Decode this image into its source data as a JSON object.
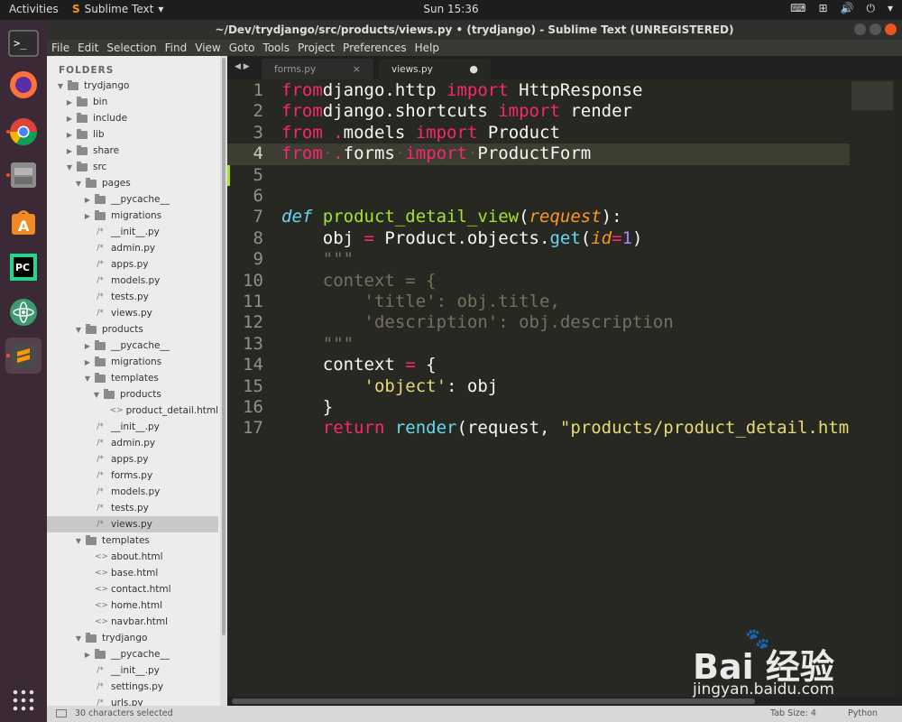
{
  "topbar": {
    "activities": "Activities",
    "app_name": "Sublime Text",
    "app_menu_arrow": "▾",
    "clock": "Sun 15:36",
    "tray": [
      "⌨",
      "⊞",
      "🔊",
      "⏻",
      "▾"
    ]
  },
  "window": {
    "title": "~/Dev/trydjango/src/products/views.py • (trydjango) - Sublime Text (UNREGISTERED)"
  },
  "menu": [
    "File",
    "Edit",
    "Selection",
    "Find",
    "View",
    "Goto",
    "Tools",
    "Project",
    "Preferences",
    "Help"
  ],
  "sidebar": {
    "header": "FOLDERS",
    "rows": [
      {
        "label": "trydjango",
        "depth": 0,
        "kind": "folder",
        "open": true
      },
      {
        "label": "bin",
        "depth": 1,
        "kind": "folder",
        "open": false
      },
      {
        "label": "include",
        "depth": 1,
        "kind": "folder",
        "open": false
      },
      {
        "label": "lib",
        "depth": 1,
        "kind": "folder",
        "open": false
      },
      {
        "label": "share",
        "depth": 1,
        "kind": "folder",
        "open": false
      },
      {
        "label": "src",
        "depth": 1,
        "kind": "folder",
        "open": true
      },
      {
        "label": "pages",
        "depth": 2,
        "kind": "folder",
        "open": true
      },
      {
        "label": "__pycache__",
        "depth": 3,
        "kind": "folder",
        "open": false
      },
      {
        "label": "migrations",
        "depth": 3,
        "kind": "folder",
        "open": false
      },
      {
        "label": "__init__.py",
        "depth": 3,
        "kind": "file"
      },
      {
        "label": "admin.py",
        "depth": 3,
        "kind": "file"
      },
      {
        "label": "apps.py",
        "depth": 3,
        "kind": "file"
      },
      {
        "label": "models.py",
        "depth": 3,
        "kind": "file"
      },
      {
        "label": "tests.py",
        "depth": 3,
        "kind": "file"
      },
      {
        "label": "views.py",
        "depth": 3,
        "kind": "file"
      },
      {
        "label": "products",
        "depth": 2,
        "kind": "folder",
        "open": true
      },
      {
        "label": "__pycache__",
        "depth": 3,
        "kind": "folder",
        "open": false
      },
      {
        "label": "migrations",
        "depth": 3,
        "kind": "folder",
        "open": false
      },
      {
        "label": "templates",
        "depth": 3,
        "kind": "folder",
        "open": true
      },
      {
        "label": "products",
        "depth": 4,
        "kind": "folder",
        "open": true
      },
      {
        "label": "product_detail.html",
        "depth": 5,
        "kind": "html"
      },
      {
        "label": "__init__.py",
        "depth": 3,
        "kind": "file"
      },
      {
        "label": "admin.py",
        "depth": 3,
        "kind": "file"
      },
      {
        "label": "apps.py",
        "depth": 3,
        "kind": "file"
      },
      {
        "label": "forms.py",
        "depth": 3,
        "kind": "file"
      },
      {
        "label": "models.py",
        "depth": 3,
        "kind": "file"
      },
      {
        "label": "tests.py",
        "depth": 3,
        "kind": "file"
      },
      {
        "label": "views.py",
        "depth": 3,
        "kind": "file",
        "selected": true
      },
      {
        "label": "templates",
        "depth": 2,
        "kind": "folder",
        "open": true
      },
      {
        "label": "about.html",
        "depth": 3,
        "kind": "html"
      },
      {
        "label": "base.html",
        "depth": 3,
        "kind": "html"
      },
      {
        "label": "contact.html",
        "depth": 3,
        "kind": "html"
      },
      {
        "label": "home.html",
        "depth": 3,
        "kind": "html"
      },
      {
        "label": "navbar.html",
        "depth": 3,
        "kind": "html"
      },
      {
        "label": "trydjango",
        "depth": 2,
        "kind": "folder",
        "open": true
      },
      {
        "label": "__pycache__",
        "depth": 3,
        "kind": "folder",
        "open": false
      },
      {
        "label": "__init__.py",
        "depth": 3,
        "kind": "file"
      },
      {
        "label": "settings.py",
        "depth": 3,
        "kind": "file"
      },
      {
        "label": "urls.py",
        "depth": 3,
        "kind": "file"
      }
    ]
  },
  "tabs": [
    {
      "label": "forms.py",
      "mark": "×",
      "active": false
    },
    {
      "label": "views.py",
      "mark": "●",
      "active": true
    }
  ],
  "tabnav": "◀ ▶",
  "editor": {
    "current_line": 4,
    "lines": [
      {
        "n": "1",
        "tokens": [
          [
            "kw",
            "from"
          ],
          [
            "",
            "django.http "
          ],
          [
            "kw",
            "import"
          ],
          [
            "",
            " HttpResponse"
          ]
        ]
      },
      {
        "n": "2",
        "tokens": [
          [
            "kw",
            "from"
          ],
          [
            "",
            "django.shortcuts "
          ],
          [
            "kw",
            "import"
          ],
          [
            "",
            " render"
          ]
        ]
      },
      {
        "n": "3",
        "tokens": [
          [
            "kw",
            "from"
          ],
          [
            "kw",
            " ."
          ],
          [
            "",
            "models "
          ],
          [
            "kw",
            "import"
          ],
          [
            "",
            " Product"
          ]
        ]
      },
      {
        "n": "4",
        "tokens": [
          [
            "kw",
            "from"
          ],
          [
            "ws",
            "·"
          ],
          [
            "kw",
            "."
          ],
          [
            "",
            "forms"
          ],
          [
            "ws",
            "·"
          ],
          [
            "kw",
            "import"
          ],
          [
            "ws",
            "·"
          ],
          [
            "",
            "ProductForm"
          ]
        ]
      },
      {
        "n": "5",
        "tokens": []
      },
      {
        "n": "6",
        "tokens": []
      },
      {
        "n": "7",
        "tokens": [
          [
            "def",
            "def"
          ],
          [
            "",
            " "
          ],
          [
            "fn",
            "product_detail_view"
          ],
          [
            "",
            "("
          ],
          [
            "param",
            "request"
          ],
          [
            "",
            "):"
          ]
        ]
      },
      {
        "n": "8",
        "tokens": [
          [
            "",
            "    obj "
          ],
          [
            "kw",
            "="
          ],
          [
            "",
            " Product.objects."
          ],
          [
            "bi",
            "get"
          ],
          [
            "",
            "("
          ],
          [
            "param",
            "id"
          ],
          [
            "kw",
            "="
          ],
          [
            "num",
            "1"
          ],
          [
            "",
            ")"
          ]
        ]
      },
      {
        "n": "9",
        "tokens": [
          [
            "cm",
            "    \"\"\""
          ]
        ]
      },
      {
        "n": "10",
        "tokens": [
          [
            "cm",
            "    context = {"
          ]
        ]
      },
      {
        "n": "11",
        "tokens": [
          [
            "cm",
            "        'title': obj.title,"
          ]
        ]
      },
      {
        "n": "12",
        "tokens": [
          [
            "cm",
            "        'description': obj.description"
          ]
        ]
      },
      {
        "n": "13",
        "tokens": [
          [
            "cm",
            "    \"\"\""
          ]
        ]
      },
      {
        "n": "14",
        "tokens": [
          [
            "",
            "    context "
          ],
          [
            "kw",
            "="
          ],
          [
            "",
            " {"
          ]
        ]
      },
      {
        "n": "15",
        "tokens": [
          [
            "",
            "        "
          ],
          [
            "str",
            "'object'"
          ],
          [
            "",
            ": obj"
          ]
        ]
      },
      {
        "n": "16",
        "tokens": [
          [
            "",
            "    }"
          ]
        ]
      },
      {
        "n": "17",
        "tokens": [
          [
            "",
            "    "
          ],
          [
            "kw",
            "return"
          ],
          [
            "",
            " "
          ],
          [
            "bi",
            "render"
          ],
          [
            "",
            "(request, "
          ],
          [
            "str",
            "\"products/product_detail.htm"
          ]
        ]
      }
    ]
  },
  "status": {
    "selection": "30 characters selected",
    "tab_size": "Tab Size: 4",
    "syntax": "Python"
  },
  "watermark": {
    "brand": "Bai 经验",
    "url": "jingyan.baidu.com"
  },
  "colors": {
    "accent": "#e95420",
    "editor_bg": "#272822",
    "keyword": "#f92672",
    "function": "#a6e22e",
    "string": "#e6db74"
  }
}
